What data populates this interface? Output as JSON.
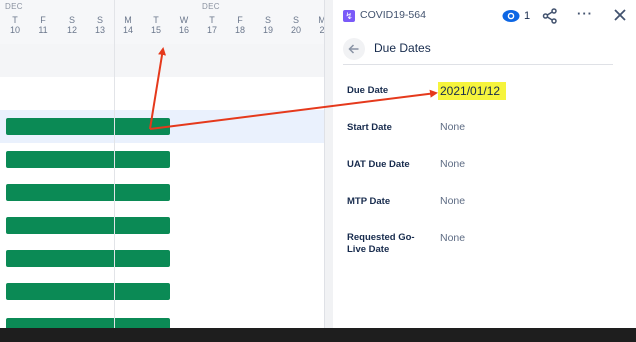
{
  "timeline": {
    "months": [
      {
        "label": "DEC"
      },
      {
        "label": "DEC"
      }
    ],
    "days": [
      {
        "wd": "T",
        "dn": "10"
      },
      {
        "wd": "F",
        "dn": "11"
      },
      {
        "wd": "S",
        "dn": "12"
      },
      {
        "wd": "S",
        "dn": "13"
      },
      {
        "wd": "M",
        "dn": "14"
      },
      {
        "wd": "T",
        "dn": "15"
      },
      {
        "wd": "W",
        "dn": "16"
      },
      {
        "wd": "T",
        "dn": "17"
      },
      {
        "wd": "F",
        "dn": "18"
      },
      {
        "wd": "S",
        "dn": "19"
      },
      {
        "wd": "S",
        "dn": "20"
      },
      {
        "wd": "M",
        "dn": "2"
      }
    ],
    "bar_color": "#0b8a55"
  },
  "panel": {
    "issue_key": "COVID19-564",
    "watch_count": "1",
    "more_label": "···",
    "section_title": "Due Dates",
    "fields": [
      {
        "label": "Due Date",
        "value": "2021/01/12"
      },
      {
        "label": "Start Date",
        "value": "None"
      },
      {
        "label": "UAT Due Date",
        "value": "None"
      },
      {
        "label": "MTP Date",
        "value": "None"
      },
      {
        "label": "Requested Go-Live Date",
        "value": "None"
      }
    ],
    "highlight_color": "#f6f43c",
    "icons": [
      "eye-icon",
      "share-icon",
      "more-icon",
      "close-icon",
      "arrow-left-icon"
    ]
  },
  "annotation": {
    "color": "#e5391c"
  }
}
